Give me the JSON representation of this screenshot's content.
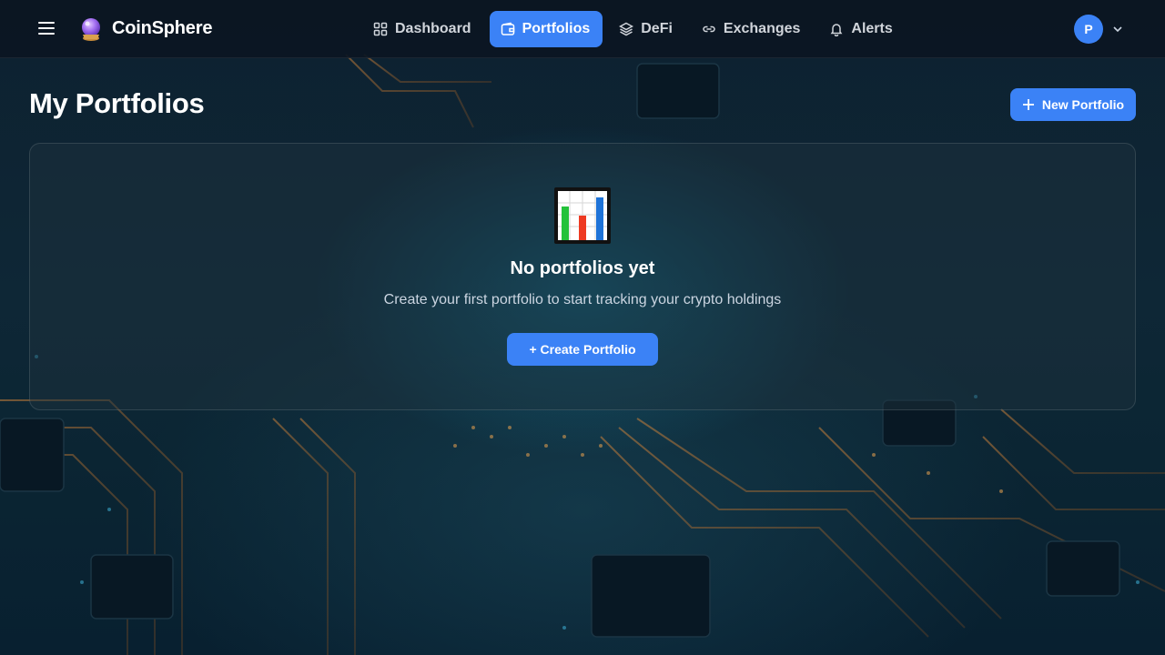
{
  "app": {
    "brand": "CoinSphere",
    "logo_icon": "crystal-ball-icon",
    "menu_icon": "hamburger-menu-icon"
  },
  "nav": {
    "items": [
      {
        "label": "Dashboard",
        "icon": "grid-icon",
        "active": false
      },
      {
        "label": "Portfolios",
        "icon": "wallet-icon",
        "active": true
      },
      {
        "label": "DeFi",
        "icon": "layers-icon",
        "active": false
      },
      {
        "label": "Exchanges",
        "icon": "link-icon",
        "active": false
      },
      {
        "label": "Alerts",
        "icon": "bell-icon",
        "active": false
      }
    ]
  },
  "user": {
    "initial": "P",
    "caret_icon": "chevron-down-icon"
  },
  "page": {
    "title": "My Portfolios",
    "new_button_label": "New Portfolio",
    "new_button_icon": "plus-icon"
  },
  "empty_state": {
    "icon": "bar-chart-icon",
    "title": "No portfolios yet",
    "description": "Create your first portfolio to start tracking your crypto holdings",
    "button_label": "+ Create Portfolio"
  },
  "colors": {
    "accent": "#3b82f6",
    "topbar": "#0b1622",
    "background": "#0d2130"
  }
}
